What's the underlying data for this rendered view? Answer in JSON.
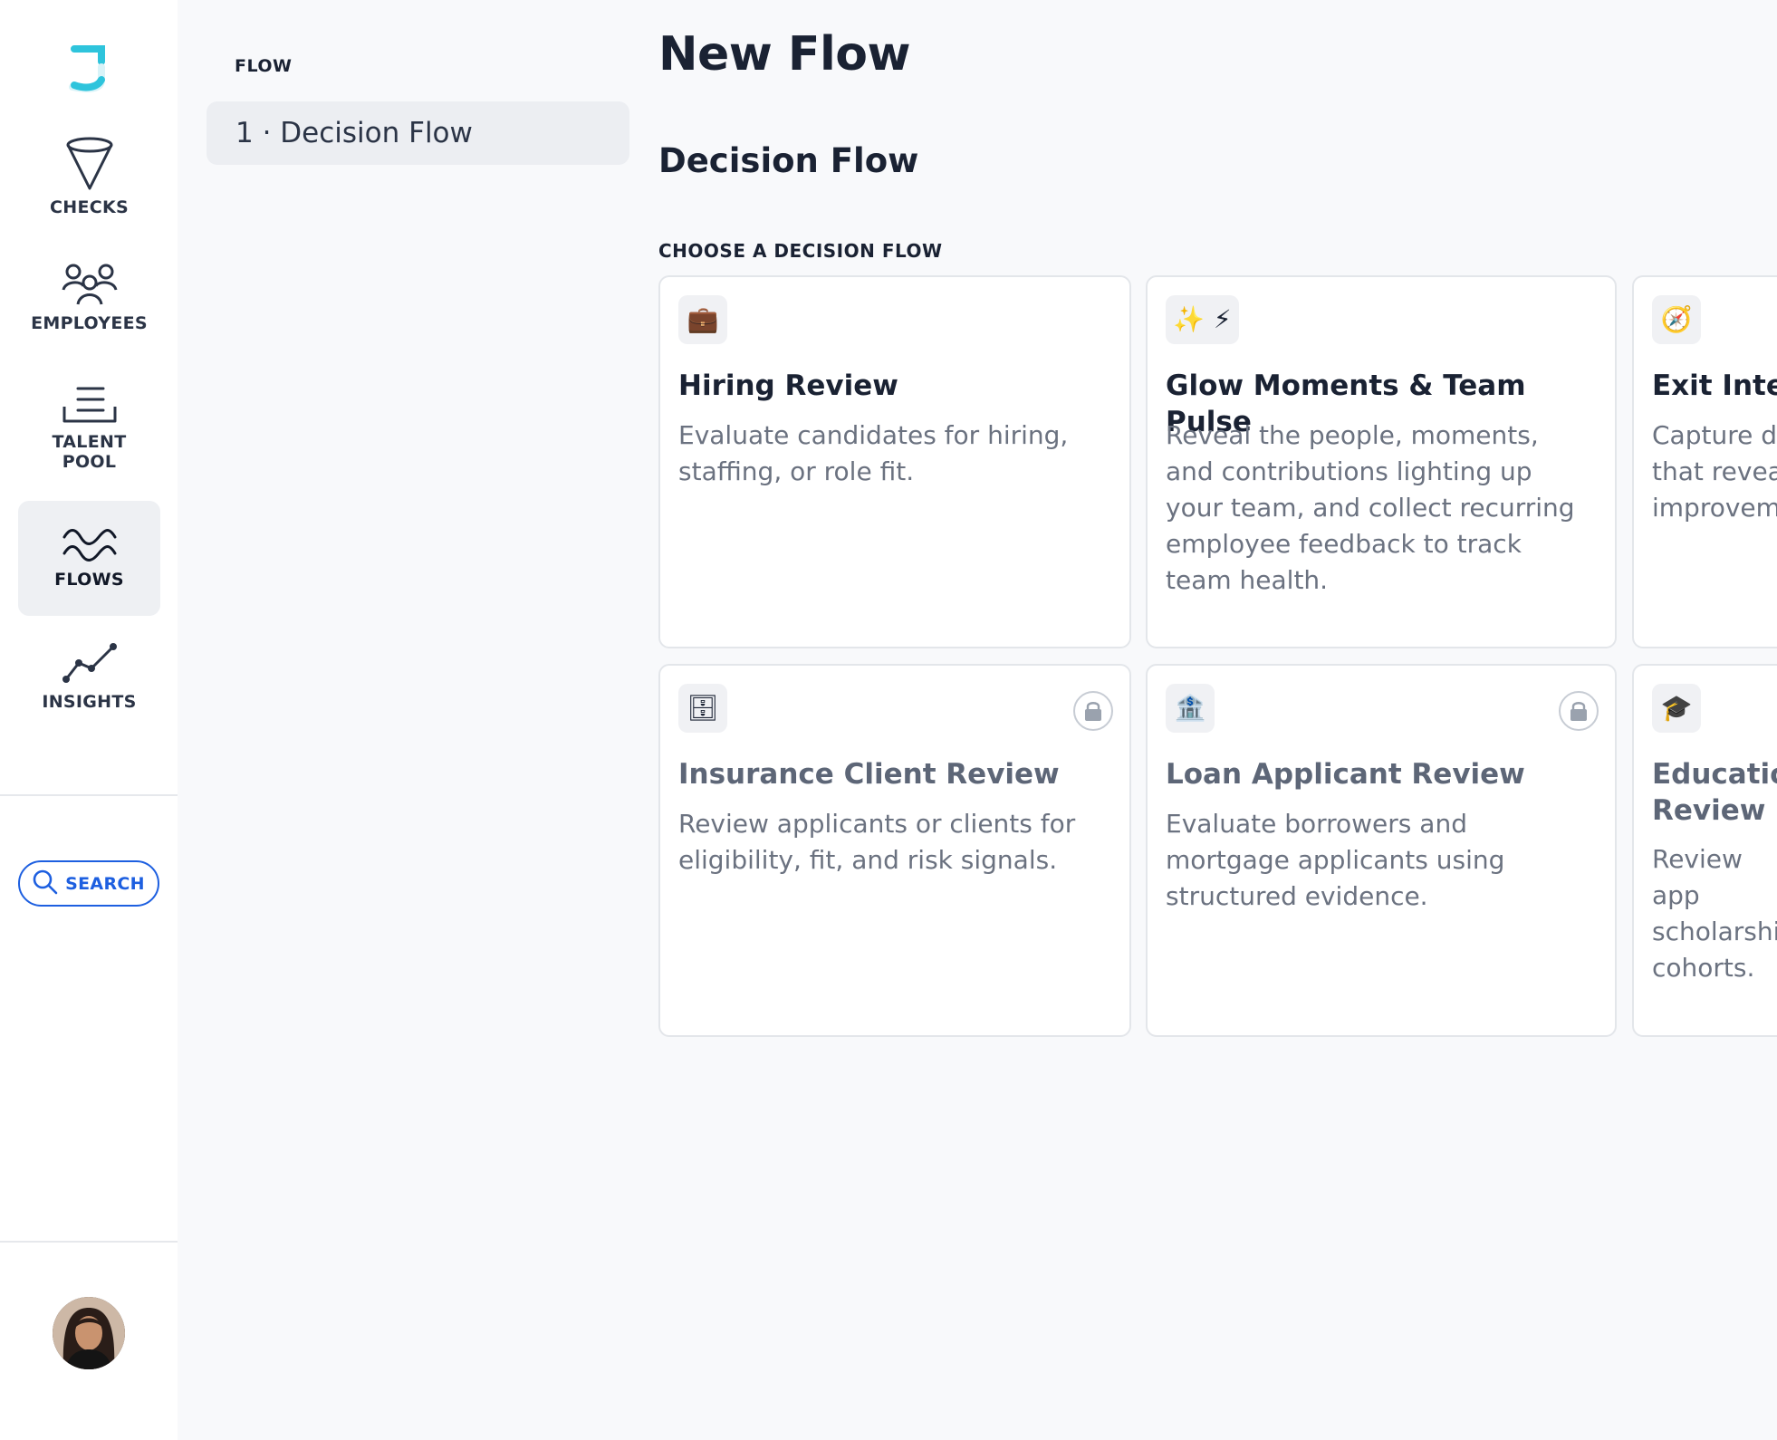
{
  "nav": {
    "items": [
      {
        "label": "CHECKS",
        "icon": "filter-icon"
      },
      {
        "label": "EMPLOYEES",
        "icon": "people-icon"
      },
      {
        "label": "TALENT POOL",
        "icon": "tray-icon"
      },
      {
        "label": "FLOWS",
        "icon": "waves-icon",
        "active": true
      },
      {
        "label": "INSIGHTS",
        "icon": "trend-line-icon"
      }
    ],
    "search_label": "SEARCH"
  },
  "flow": {
    "heading": "FLOW",
    "steps": [
      "1 · Decision Flow"
    ]
  },
  "main": {
    "title": "New Flow",
    "section_title": "Decision Flow",
    "choose_label": "CHOOSE A DECISION FLOW",
    "cards": [
      {
        "title": "Hiring Review",
        "description": "Evaluate candidates for hiring, staffing, or role fit.",
        "icons": [
          "💼"
        ],
        "locked": false
      },
      {
        "title": "Glow Moments & Team Pulse",
        "description": "Reveal the people, moments, and contributions lighting up your team, and collect recurring employee feedback to track team health.",
        "icons": [
          "✨",
          "⚡"
        ],
        "locked": false
      },
      {
        "title": "Exit Intel",
        "description": "Capture de that reveal improveme",
        "icons": [
          "🧭"
        ],
        "locked": false
      },
      {
        "title": "Insurance Client Review",
        "description": "Review applicants or clients for eligibility, fit, and risk signals.",
        "icons": [
          "🗄"
        ],
        "locked": true
      },
      {
        "title": "Loan Applicant Review",
        "description": "Evaluate borrowers and mortgage applicants using structured evidence.",
        "icons": [
          "🏦"
        ],
        "locked": true
      },
      {
        "title": "Educatio Review",
        "description": "Review app scholarshi cohorts.",
        "icons": [
          "🎓"
        ],
        "locked": false
      }
    ]
  },
  "colors": {
    "accent": "#1d5fe0",
    "logo": "#2ec4dc",
    "text": "#1a2233",
    "muted": "#6b7280"
  }
}
